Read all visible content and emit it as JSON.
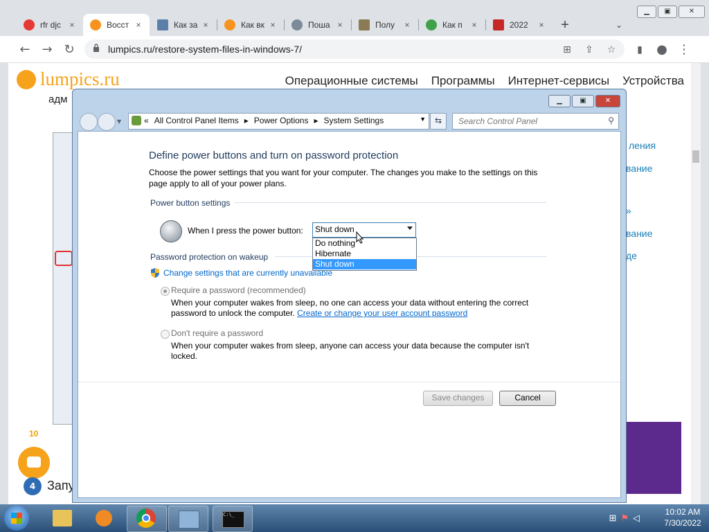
{
  "browser": {
    "tabs": [
      {
        "title": "rfr djc",
        "fav_color": "#e53935"
      },
      {
        "title": "Восст",
        "fav_color": "#f7931e",
        "active": true
      },
      {
        "title": "Как за",
        "fav_color": "#5b7fa8"
      },
      {
        "title": "Как вк",
        "fav_color": "#f7931e"
      },
      {
        "title": "Поша",
        "fav_color": "#7c8a99"
      },
      {
        "title": "Полу",
        "fav_color": "#8a7b55"
      },
      {
        "title": "Как п",
        "fav_color": "#3fa24a"
      },
      {
        "title": "2022",
        "fav_color": "#c62828"
      }
    ],
    "new_tab": "+",
    "tab_close": "×",
    "url": "lumpics.ru/restore-system-files-in-windows-7/"
  },
  "site": {
    "logo": "lumpics.ru",
    "nav": [
      "Операционные системы",
      "Программы",
      "Интернет-сервисы",
      "Устройства"
    ],
    "fragment_left": "адм",
    "side_links": [
      "ления",
      "вание",
      "»",
      "вание",
      "де"
    ],
    "badge_10": "10",
    "step_num": "4",
    "step_text": "Запу"
  },
  "cp": {
    "breadcrumb": [
      "All Control Panel Items",
      "Power Options",
      "System Settings"
    ],
    "search_placeholder": "Search Control Panel",
    "title": "Define power buttons and turn on password protection",
    "desc": "Choose the power settings that you want for your computer. The changes you make to the settings on this page apply to all of your power plans.",
    "power_section": "Power button settings",
    "power_label": "When I press the power button:",
    "dropdown_value": "Shut down",
    "dropdown_options": [
      "Do nothing",
      "Hibernate",
      "Shut down"
    ],
    "password_section": "Password protection on wakeup",
    "change_settings_link": "Change settings that are currently unavailable",
    "opt1_title": "Require a password (recommended)",
    "opt1_desc_a": "When your computer wakes from sleep, no one can access your data without entering the correct",
    "opt1_desc_b": "password to unlock the computer.",
    "opt1_link": "Create or change your user account password",
    "opt2_title": "Don't require a password",
    "opt2_desc": "When your computer wakes from sleep, anyone can access your data because the computer isn't locked.",
    "save_btn": "Save changes",
    "cancel_btn": "Cancel"
  },
  "taskbar": {
    "time": "10:02 AM",
    "date": "7/30/2022"
  }
}
